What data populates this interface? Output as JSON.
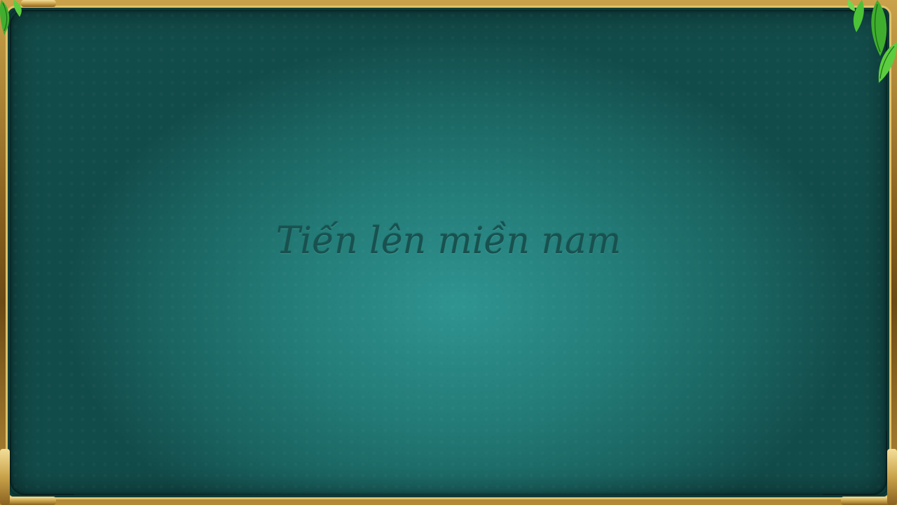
{
  "title": "Tiến lên miền nam",
  "colors": {
    "felt_center": "#2f9490",
    "felt_edge": "#124c4a",
    "frame_gold": "#c9a24a",
    "title_text": "#18514f"
  },
  "decorations": {
    "top_left": "bamboo-leaves-icon",
    "top_right": "bamboo-leaves-icon"
  }
}
